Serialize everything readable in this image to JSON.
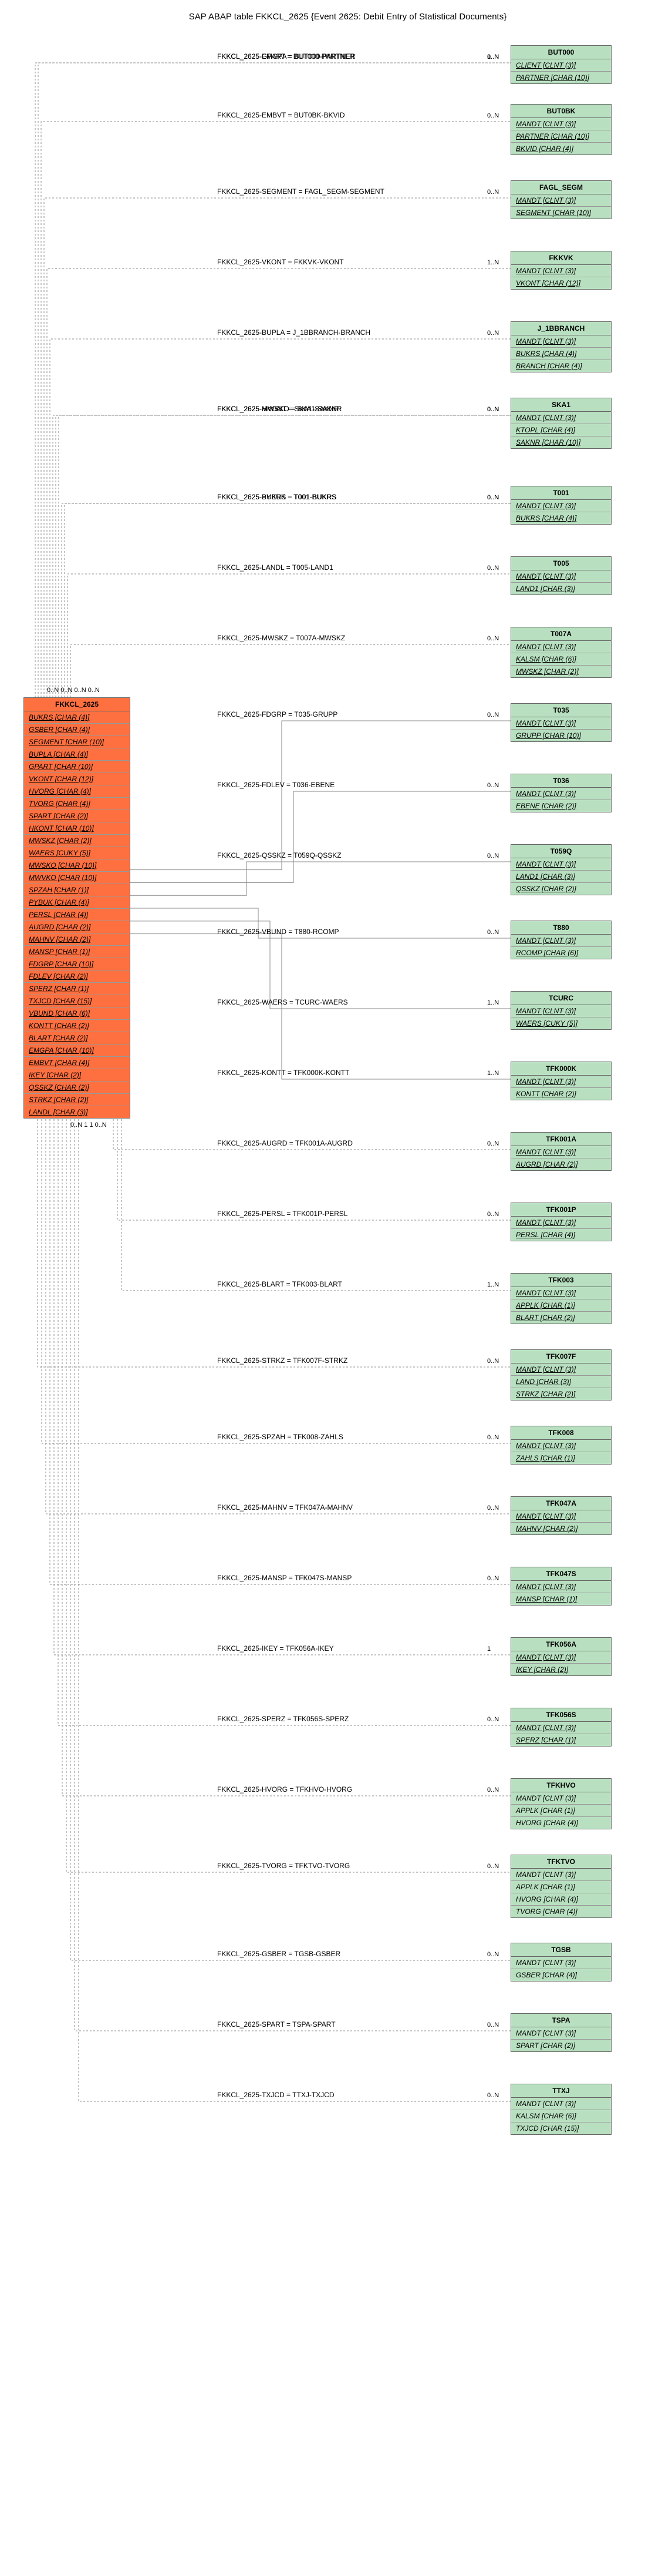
{
  "title": "SAP ABAP table FKKCL_2625 {Event 2625: Debit Entry of Statistical Documents}",
  "source": {
    "name": "FKKCL_2625",
    "fields": [
      {
        "t": "BUKRS [CHAR (4)]",
        "u": 1
      },
      {
        "t": "GSBER [CHAR (4)]",
        "u": 1
      },
      {
        "t": "SEGMENT [CHAR (10)]",
        "u": 1
      },
      {
        "t": "BUPLA [CHAR (4)]",
        "u": 1
      },
      {
        "t": "GPART [CHAR (10)]",
        "u": 1
      },
      {
        "t": "VKONT [CHAR (12)]",
        "u": 1
      },
      {
        "t": "HVORG [CHAR (4)]",
        "u": 1
      },
      {
        "t": "TVORG [CHAR (4)]",
        "u": 1
      },
      {
        "t": "SPART [CHAR (2)]",
        "u": 1
      },
      {
        "t": "HKONT [CHAR (10)]",
        "u": 1
      },
      {
        "t": "MWSKZ [CHAR (2)]",
        "u": 1
      },
      {
        "t": "WAERS [CUKY (5)]",
        "u": 1
      },
      {
        "t": "MWSKO [CHAR (10)]",
        "u": 1
      },
      {
        "t": "MWVKO [CHAR (10)]",
        "u": 1
      },
      {
        "t": "SPZAH [CHAR (1)]",
        "u": 1
      },
      {
        "t": "PYBUK [CHAR (4)]",
        "u": 1
      },
      {
        "t": "PERSL [CHAR (4)]",
        "u": 1
      },
      {
        "t": "AUGRD [CHAR (2)]",
        "u": 1
      },
      {
        "t": "MAHNV [CHAR (2)]",
        "u": 1
      },
      {
        "t": "MANSP [CHAR (1)]",
        "u": 1
      },
      {
        "t": "FDGRP [CHAR (10)]",
        "u": 1
      },
      {
        "t": "FDLEV [CHAR (2)]",
        "u": 1
      },
      {
        "t": "SPERZ [CHAR (1)]",
        "u": 1
      },
      {
        "t": "TXJCD [CHAR (15)]",
        "u": 1
      },
      {
        "t": "VBUND [CHAR (6)]",
        "u": 1
      },
      {
        "t": "KONTT [CHAR (2)]",
        "u": 1
      },
      {
        "t": "BLART [CHAR (2)]",
        "u": 1
      },
      {
        "t": "EMGPA [CHAR (10)]",
        "u": 1
      },
      {
        "t": "EMBVT [CHAR (4)]",
        "u": 1
      },
      {
        "t": "IKEY [CHAR (2)]",
        "u": 1
      },
      {
        "t": "QSSKZ [CHAR (2)]",
        "u": 1
      },
      {
        "t": "STRKZ [CHAR (2)]",
        "u": 1
      },
      {
        "t": "LANDL [CHAR (3)]",
        "u": 1
      }
    ]
  },
  "targets": [
    {
      "name": "BUT000",
      "fields": [
        {
          "t": "CLIENT [CLNT (3)]",
          "u": 1
        },
        {
          "t": "PARTNER [CHAR (10)]",
          "u": 1
        }
      ]
    },
    {
      "name": "BUT0BK",
      "fields": [
        {
          "t": "MANDT [CLNT (3)]",
          "u": 1
        },
        {
          "t": "PARTNER [CHAR (10)]",
          "u": 1
        },
        {
          "t": "BKVID [CHAR (4)]",
          "u": 1
        }
      ]
    },
    {
      "name": "FAGL_SEGM",
      "fields": [
        {
          "t": "MANDT [CLNT (3)]",
          "u": 1
        },
        {
          "t": "SEGMENT [CHAR (10)]",
          "u": 1
        }
      ]
    },
    {
      "name": "FKKVK",
      "fields": [
        {
          "t": "MANDT [CLNT (3)]",
          "u": 1
        },
        {
          "t": "VKONT [CHAR (12)]",
          "u": 1
        }
      ]
    },
    {
      "name": "J_1BBRANCH",
      "fields": [
        {
          "t": "MANDT [CLNT (3)]",
          "u": 1
        },
        {
          "t": "BUKRS [CHAR (4)]",
          "u": 1
        },
        {
          "t": "BRANCH [CHAR (4)]",
          "u": 1
        }
      ]
    },
    {
      "name": "SKA1",
      "fields": [
        {
          "t": "MANDT [CLNT (3)]",
          "u": 1
        },
        {
          "t": "KTOPL [CHAR (4)]",
          "u": 1
        },
        {
          "t": "SAKNR [CHAR (10)]",
          "u": 1
        }
      ]
    },
    {
      "name": "T001",
      "fields": [
        {
          "t": "MANDT [CLNT (3)]",
          "u": 1
        },
        {
          "t": "BUKRS [CHAR (4)]",
          "u": 1
        }
      ]
    },
    {
      "name": "T005",
      "fields": [
        {
          "t": "MANDT [CLNT (3)]",
          "u": 1
        },
        {
          "t": "LAND1 [CHAR (3)]",
          "u": 1
        }
      ]
    },
    {
      "name": "T007A",
      "fields": [
        {
          "t": "MANDT [CLNT (3)]",
          "u": 1
        },
        {
          "t": "KALSM [CHAR (6)]",
          "u": 1
        },
        {
          "t": "MWSKZ [CHAR (2)]",
          "u": 1
        }
      ]
    },
    {
      "name": "T035",
      "fields": [
        {
          "t": "MANDT [CLNT (3)]",
          "u": 1
        },
        {
          "t": "GRUPP [CHAR (10)]",
          "u": 1
        }
      ]
    },
    {
      "name": "T036",
      "fields": [
        {
          "t": "MANDT [CLNT (3)]",
          "u": 1
        },
        {
          "t": "EBENE [CHAR (2)]",
          "u": 1
        }
      ]
    },
    {
      "name": "T059Q",
      "fields": [
        {
          "t": "MANDT [CLNT (3)]",
          "u": 1
        },
        {
          "t": "LAND1 [CHAR (3)]",
          "u": 1
        },
        {
          "t": "QSSKZ [CHAR (2)]",
          "u": 1
        }
      ]
    },
    {
      "name": "T880",
      "fields": [
        {
          "t": "MANDT [CLNT (3)]",
          "u": 1
        },
        {
          "t": "RCOMP [CHAR (6)]",
          "u": 1
        }
      ]
    },
    {
      "name": "TCURC",
      "fields": [
        {
          "t": "MANDT [CLNT (3)]",
          "u": 1
        },
        {
          "t": "WAERS [CUKY (5)]",
          "u": 1
        }
      ]
    },
    {
      "name": "TFK000K",
      "fields": [
        {
          "t": "MANDT [CLNT (3)]",
          "u": 1
        },
        {
          "t": "KONTT [CHAR (2)]",
          "u": 1
        }
      ]
    },
    {
      "name": "TFK001A",
      "fields": [
        {
          "t": "MANDT [CLNT (3)]",
          "u": 1
        },
        {
          "t": "AUGRD [CHAR (2)]",
          "u": 1
        }
      ]
    },
    {
      "name": "TFK001P",
      "fields": [
        {
          "t": "MANDT [CLNT (3)]",
          "u": 1
        },
        {
          "t": "PERSL [CHAR (4)]",
          "u": 1
        }
      ]
    },
    {
      "name": "TFK003",
      "fields": [
        {
          "t": "MANDT [CLNT (3)]",
          "u": 1
        },
        {
          "t": "APPLK [CHAR (1)]",
          "u": 1
        },
        {
          "t": "BLART [CHAR (2)]",
          "u": 1
        }
      ]
    },
    {
      "name": "TFK007F",
      "fields": [
        {
          "t": "MANDT [CLNT (3)]",
          "u": 1
        },
        {
          "t": "LAND [CHAR (3)]",
          "u": 1
        },
        {
          "t": "STRKZ [CHAR (2)]",
          "u": 1
        }
      ]
    },
    {
      "name": "TFK008",
      "fields": [
        {
          "t": "MANDT [CLNT (3)]",
          "u": 1
        },
        {
          "t": "ZAHLS [CHAR (1)]",
          "u": 1
        }
      ]
    },
    {
      "name": "TFK047A",
      "fields": [
        {
          "t": "MANDT [CLNT (3)]",
          "u": 1
        },
        {
          "t": "MAHNV [CHAR (2)]",
          "u": 1
        }
      ]
    },
    {
      "name": "TFK047S",
      "fields": [
        {
          "t": "MANDT [CLNT (3)]",
          "u": 1
        },
        {
          "t": "MANSP [CHAR (1)]",
          "u": 1
        }
      ]
    },
    {
      "name": "TFK056A",
      "fields": [
        {
          "t": "MANDT [CLNT (3)]",
          "u": 1
        },
        {
          "t": "IKEY [CHAR (2)]",
          "u": 1
        }
      ]
    },
    {
      "name": "TFK056S",
      "fields": [
        {
          "t": "MANDT [CLNT (3)]",
          "u": 1
        },
        {
          "t": "SPERZ [CHAR (1)]",
          "u": 1
        }
      ]
    },
    {
      "name": "TFKHVO",
      "fields": [
        {
          "t": "MANDT [CLNT (3)]",
          "u": 0
        },
        {
          "t": "APPLK [CHAR (1)]",
          "u": 0
        },
        {
          "t": "HVORG [CHAR (4)]",
          "u": 0
        }
      ]
    },
    {
      "name": "TFKTVO",
      "fields": [
        {
          "t": "MANDT [CLNT (3)]",
          "u": 0
        },
        {
          "t": "APPLK [CHAR (1)]",
          "u": 0
        },
        {
          "t": "HVORG [CHAR (4)]",
          "u": 0
        },
        {
          "t": "TVORG [CHAR (4)]",
          "u": 0
        }
      ]
    },
    {
      "name": "TGSB",
      "fields": [
        {
          "t": "MANDT [CLNT (3)]",
          "u": 0
        },
        {
          "t": "GSBER [CHAR (4)]",
          "u": 0
        }
      ]
    },
    {
      "name": "TSPA",
      "fields": [
        {
          "t": "MANDT [CLNT (3)]",
          "u": 0
        },
        {
          "t": "SPART [CHAR (2)]",
          "u": 0
        }
      ]
    },
    {
      "name": "TTXJ",
      "fields": [
        {
          "t": "MANDT [CLNT (3)]",
          "u": 0
        },
        {
          "t": "KALSM [CHAR (6)]",
          "u": 0
        },
        {
          "t": "TXJCD [CHAR (15)]",
          "u": 0
        }
      ]
    }
  ],
  "edges": [
    {
      "label": "FKKCL_2625-EMGPA = BUT000-PARTNER",
      "c1": "0..N",
      "c2": "0..N"
    },
    {
      "label": "FKKCL_2625-GPART = BUT000-PARTNER",
      "c1": "0..N",
      "c2": "1..N"
    },
    {
      "label": "FKKCL_2625-EMBVT = BUT0BK-BKVID",
      "c1": "0..N",
      "c2": "0..N"
    },
    {
      "label": "FKKCL_2625-SEGMENT = FAGL_SEGM-SEGMENT",
      "c1": "0..N",
      "c2": "0..N"
    },
    {
      "label": "FKKCL_2625-VKONT = FKKVK-VKONT",
      "c1": "0..N",
      "c2": "1..N"
    },
    {
      "label": "FKKCL_2625-BUPLA = J_1BBRANCH-BRANCH",
      "c1": "0..N",
      "c2": "0..N"
    },
    {
      "label": "FKKCL_2625-HKONT = SKA1-SAKNR",
      "c1": "0..N",
      "c2": "0..N"
    },
    {
      "label": "FKKCL_2625-MWSKO = SKA1-SAKNR",
      "c1": "0..N",
      "c2": "0..N"
    },
    {
      "label": "FKKCL_2625-MWVKO = SKA1-SAKNR",
      "c1": "0..N",
      "c2": "0..N"
    },
    {
      "label": "FKKCL_2625-BUKRS = T001-BUKRS",
      "c1": "0..N",
      "c2": "0..N"
    },
    {
      "label": "FKKCL_2625-PYBUK = T001-BUKRS",
      "c1": "0..N",
      "c2": "0..N"
    },
    {
      "label": "FKKCL_2625-LANDL = T005-LAND1",
      "c1": "1",
      "c2": "0..N"
    },
    {
      "label": "FKKCL_2625-MWSKZ = T007A-MWSKZ",
      "c1": "0..N",
      "c2": "0..N"
    },
    {
      "label": "FKKCL_2625-FDGRP = T035-GRUPP",
      "c1": "1",
      "c2": "0..N"
    },
    {
      "label": "FKKCL_2625-FDLEV = T036-EBENE",
      "c1": "1",
      "c2": "0..N"
    },
    {
      "label": "FKKCL_2625-QSSKZ = T059Q-QSSKZ",
      "c1": "1",
      "c2": "0..N"
    },
    {
      "label": "FKKCL_2625-VBUND = T880-RCOMP",
      "c1": "0..N",
      "c2": "0..N"
    },
    {
      "label": "FKKCL_2625-WAERS = TCURC-WAERS",
      "c1": "1",
      "c2": "1..N"
    },
    {
      "label": "FKKCL_2625-KONTT = TFK000K-KONTT",
      "c1": "1",
      "c2": "1..N"
    },
    {
      "label": "FKKCL_2625-AUGRD = TFK001A-AUGRD",
      "c1": "1",
      "c2": "0..N"
    },
    {
      "label": "FKKCL_2625-PERSL = TFK001P-PERSL",
      "c1": "1",
      "c2": "0..N"
    },
    {
      "label": "FKKCL_2625-BLART = TFK003-BLART",
      "c1": "0..N",
      "c2": "1..N"
    },
    {
      "label": "FKKCL_2625-STRKZ = TFK007F-STRKZ",
      "c1": "0..N",
      "c2": "0..N"
    },
    {
      "label": "FKKCL_2625-SPZAH = TFK008-ZAHLS",
      "c1": "0..N",
      "c2": "0..N"
    },
    {
      "label": "FKKCL_2625-MAHNV = TFK047A-MAHNV",
      "c1": "0..N",
      "c2": "0..N"
    },
    {
      "label": "FKKCL_2625-MANSP = TFK047S-MANSP",
      "c1": "0..N",
      "c2": "0..N"
    },
    {
      "label": "FKKCL_2625-IKEY = TFK056A-IKEY",
      "c1": "0..N",
      "c2": "1"
    },
    {
      "label": "FKKCL_2625-SPERZ = TFK056S-SPERZ",
      "c1": "0..N",
      "c2": "0..N"
    },
    {
      "label": "FKKCL_2625-HVORG = TFKHVO-HVORG",
      "c1": "0..N",
      "c2": "0..N"
    },
    {
      "label": "FKKCL_2625-TVORG = TFKTVO-TVORG",
      "c1": "0..N",
      "c2": "0..N"
    },
    {
      "label": "FKKCL_2625-GSBER = TGSB-GSBER",
      "c1": "0..N",
      "c2": "0..N"
    },
    {
      "label": "FKKCL_2625-SPART = TSPA-SPART",
      "c1": "0..N",
      "c2": "0..N"
    },
    {
      "label": "FKKCL_2625-TXJCD = TTXJ-TXJCD",
      "c1": "0..N",
      "c2": "0..N"
    }
  ],
  "src_cards": "0..N 0..N 0..N 0..N",
  "src_cards2": "0..N 1 1 0..N"
}
